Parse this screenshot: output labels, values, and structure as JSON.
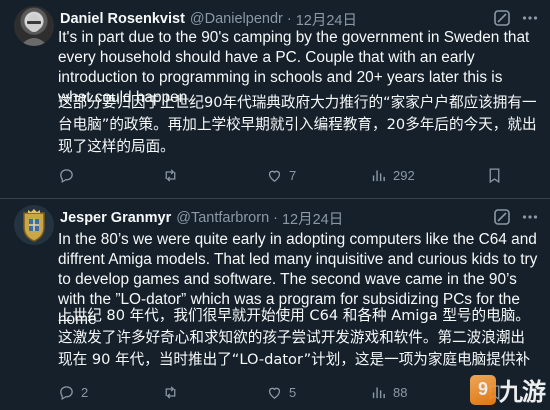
{
  "tweets": [
    {
      "author": "Daniel Rosenkvist",
      "handle": "@Danielpendr",
      "separator": "·",
      "date": "12月24日",
      "text_en": "It's in part due to the 90's camping by the government in Sweden that every household should have a PC. Couple that with an early introduction to programming in schools and 20+ years later this is what could happen.",
      "text_zh": "这部分要归因于上世纪90年代瑞典政府大力推行的“家家户户都应该拥有一台电脑”的政策。再加上学校早期就引入编程教育，20多年后的今天，就出现了这样的局面。",
      "replies": "",
      "retweets": "",
      "likes": "7",
      "views": "292",
      "avatar_icon": "profile-photo"
    },
    {
      "author": "Jesper Granmyr",
      "handle": "@Tantfarbrorn",
      "separator": "·",
      "date": "12月24日",
      "text_en": "In the 80’s we were quite early in adopting computers like the C64 and diffrent Amiga models. That led many inquisitive and curious kids to try to develop games and software. The second wave came in the 90’s with the ”LO-dator” which was a program for subsidizing PCs for the home",
      "text_zh": "上世纪 80 年代，我们很早就开始使用 C64 和各种 Amiga 型号的电脑。这激发了许多好奇心和求知欲的孩子尝试开发游戏和软件。第二波浪潮出现在 90 年代，当时推出了“LO-dator”计划，这是一项为家庭电脑提供补",
      "replies": "2",
      "retweets": "",
      "likes": "5",
      "views": "88",
      "avatar_icon": "crest-avatar"
    }
  ],
  "icons": {
    "grok": "grok-icon",
    "more": "more-icon",
    "reply": "reply-icon",
    "retweet": "retweet-icon",
    "like": "heart-icon",
    "views": "views-icon",
    "bookmark": "bookmark-icon"
  },
  "watermark": {
    "text": "九游",
    "badge": "9"
  },
  "colors": {
    "background": "#15202b",
    "text": "#f7f9f9",
    "muted": "#8b98a5",
    "divider": "#38444d",
    "watermark": "#f07e12"
  }
}
